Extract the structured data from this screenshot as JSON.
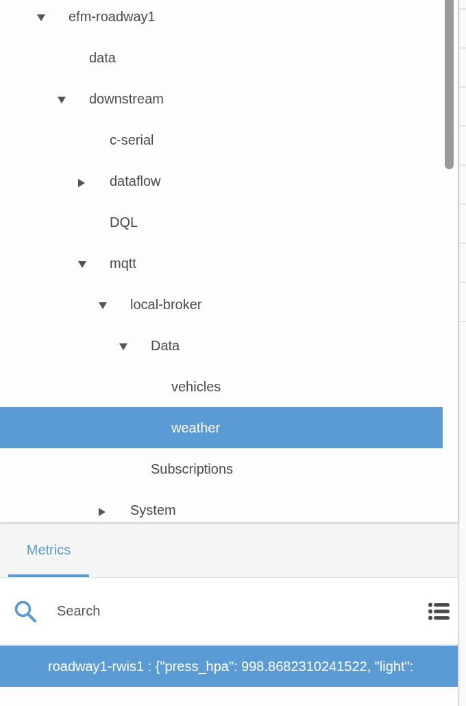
{
  "tree": [
    {
      "label": "efm-roadway1",
      "expanded": true,
      "selected": false,
      "children": [
        {
          "label": "data",
          "selected": false
        },
        {
          "label": "downstream",
          "expanded": true,
          "selected": false,
          "children": [
            {
              "label": "c-serial",
              "selected": false
            },
            {
              "label": "dataflow",
              "expanded": false,
              "selected": false
            },
            {
              "label": "DQL",
              "selected": false
            },
            {
              "label": "mqtt",
              "expanded": true,
              "selected": false,
              "children": [
                {
                  "label": "local-broker",
                  "expanded": true,
                  "selected": false,
                  "children": [
                    {
                      "label": "Data",
                      "expanded": true,
                      "selected": false,
                      "children": [
                        {
                          "label": "vehicles",
                          "selected": false
                        },
                        {
                          "label": "weather",
                          "selected": true
                        }
                      ]
                    },
                    {
                      "label": "Subscriptions",
                      "selected": false
                    }
                  ]
                },
                {
                  "label": "System",
                  "expanded": false,
                  "selected": false
                }
              ]
            }
          ]
        }
      ]
    }
  ],
  "tabs": [
    {
      "label": "Metrics",
      "selected": true
    }
  ],
  "search": {
    "placeholder": "Search"
  },
  "metrics": [
    {
      "text": "roadway1-rwis1 : {\"press_hpa\": 998.8682310241522, \"light\":",
      "selected": true
    }
  ]
}
